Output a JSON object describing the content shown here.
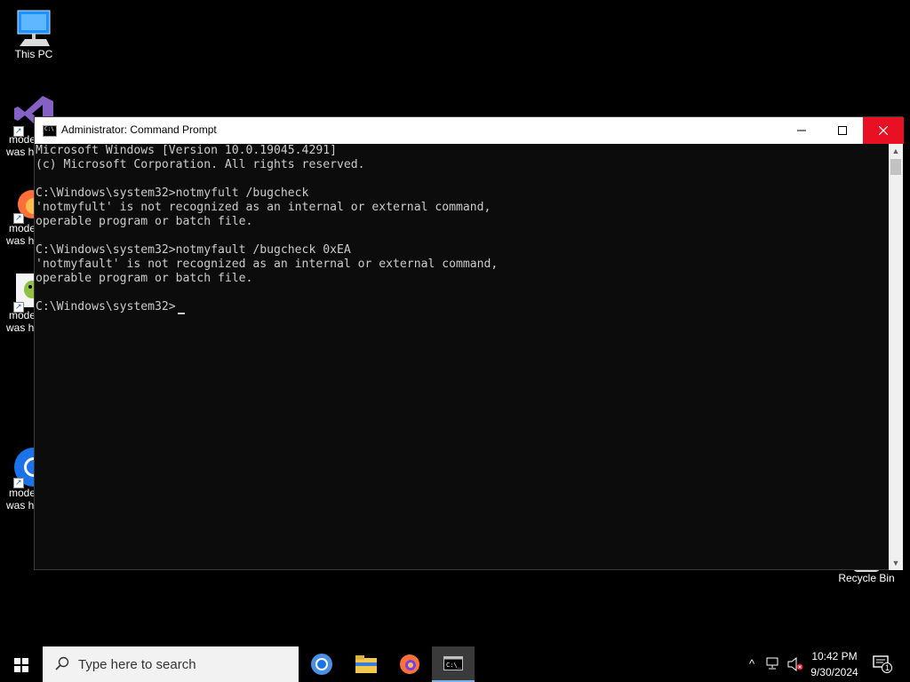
{
  "desktop": {
    "icons": [
      {
        "label": "This PC"
      },
      {
        "label1": "mode",
        "label2": "was h"
      },
      {
        "label1": "mode",
        "label2": "was h"
      },
      {
        "label1": "mode",
        "label2": "was h"
      },
      {
        "label1": "mode",
        "label2": "was h"
      },
      {
        "label": "Recycle Bin"
      }
    ]
  },
  "window": {
    "title": "Administrator: Command Prompt",
    "console_lines": [
      "Microsoft Windows [Version 10.0.19045.4291]",
      "(c) Microsoft Corporation. All rights reserved.",
      "",
      "C:\\Windows\\system32>notmyfult /bugcheck",
      "'notmyfult' is not recognized as an internal or external command,",
      "operable program or batch file.",
      "",
      "C:\\Windows\\system32>notmyfault /bugcheck 0xEA",
      "'notmyfault' is not recognized as an internal or external command,",
      "operable program or batch file.",
      "",
      "C:\\Windows\\system32>"
    ]
  },
  "taskbar": {
    "search_placeholder": "Type here to search",
    "time": "10:42 PM",
    "date": "9/30/2024",
    "notification_count": "1"
  },
  "colors": {
    "console_bg": "#0c0c0c",
    "console_text": "#cccccc",
    "close_button": "#e81123"
  }
}
